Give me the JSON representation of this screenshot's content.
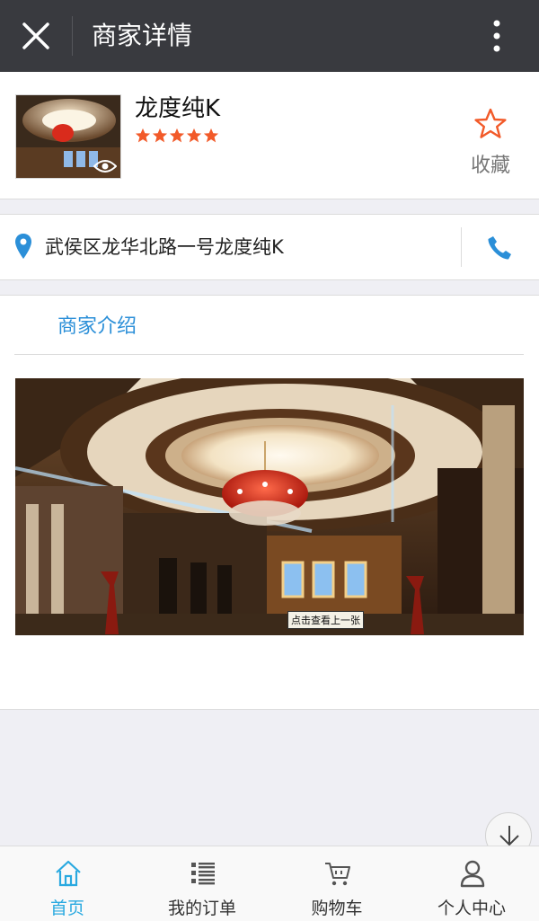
{
  "header": {
    "title": "商家详情",
    "close_icon": "close-icon",
    "more_icon": "more-vertical-icon"
  },
  "shop": {
    "name": "龙度纯K",
    "rating": 5,
    "star_color": "#f25a29",
    "favorite_label": "收藏"
  },
  "address": {
    "text": "武侯区龙华北路一号龙度纯K",
    "pin_color": "#2b8fd8",
    "phone_color": "#2b8fd8"
  },
  "intro": {
    "tab_label": "商家介绍",
    "photo_caption": "点击查看上一张"
  },
  "tabbar": {
    "items": [
      {
        "label": "首页",
        "icon": "home-icon",
        "active": true
      },
      {
        "label": "我的订单",
        "icon": "order-list-icon",
        "active": false
      },
      {
        "label": "购物车",
        "icon": "cart-icon",
        "active": false
      },
      {
        "label": "个人中心",
        "icon": "user-icon",
        "active": false
      }
    ],
    "active_color": "#29a9e0"
  }
}
